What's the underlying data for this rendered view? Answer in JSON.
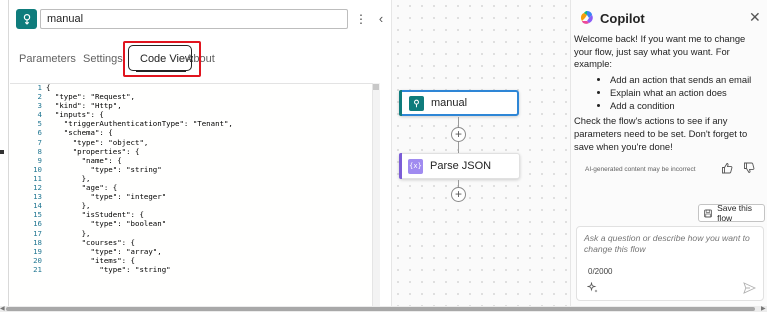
{
  "action_panel": {
    "name_value": "manual",
    "more_label": "⋮",
    "collapse_label": "‹",
    "tabs": [
      {
        "label": "Parameters"
      },
      {
        "label": "Settings"
      },
      {
        "label": "Code View"
      },
      {
        "label": "About"
      }
    ],
    "active_tab": "Code View",
    "code_lines": [
      {
        "n": "1",
        "text": "{"
      },
      {
        "n": "2",
        "text": "  \"type\": \"Request\","
      },
      {
        "n": "3",
        "text": "  \"kind\": \"Http\","
      },
      {
        "n": "4",
        "text": "  \"inputs\": {"
      },
      {
        "n": "5",
        "text": "    \"triggerAuthenticationType\": \"Tenant\","
      },
      {
        "n": "6",
        "text": "    \"schema\": {"
      },
      {
        "n": "7",
        "text": "      \"type\": \"object\","
      },
      {
        "n": "8",
        "text": "      \"properties\": {"
      },
      {
        "n": "9",
        "text": "        \"name\": {"
      },
      {
        "n": "10",
        "text": "          \"type\": \"string\""
      },
      {
        "n": "11",
        "text": "        },"
      },
      {
        "n": "12",
        "text": "        \"age\": {"
      },
      {
        "n": "13",
        "text": "          \"type\": \"integer\""
      },
      {
        "n": "14",
        "text": "        },"
      },
      {
        "n": "15",
        "text": "        \"isStudent\": {"
      },
      {
        "n": "16",
        "text": "          \"type\": \"boolean\""
      },
      {
        "n": "17",
        "text": "        },"
      },
      {
        "n": "18",
        "text": "        \"courses\": {"
      },
      {
        "n": "19",
        "text": "          \"type\": \"array\","
      },
      {
        "n": "20",
        "text": "          \"items\": {"
      },
      {
        "n": "21",
        "text": "            \"type\": \"string\""
      }
    ]
  },
  "canvas": {
    "nodes": [
      {
        "label": "manual"
      },
      {
        "label": "Parse JSON",
        "icon_text": "{x}"
      }
    ],
    "add_label": "+"
  },
  "copilot": {
    "title": "Copilot",
    "close_label": "✕",
    "intro": "Welcome back! If you want me to change your flow, just say what you want. For example:",
    "suggestions": [
      "Add an action that sends an email",
      "Explain what an action does",
      "Add a condition"
    ],
    "followup": "Check the flow's actions to see if any parameters need to be set. Don't forget to save when you're done!",
    "disclaimer": "AI-generated content may be incorrect",
    "save_label": "Save this flow",
    "prompt_placeholder": "Ask a question or describe how you want to change this flow",
    "char_count": "0/2000"
  },
  "colors": {
    "accent_teal": "#0f7c7c",
    "selected_border": "#2e86d6",
    "annotation_red": "#e0141e",
    "parse_icon": "#a08bf0"
  },
  "icons": [
    "trigger-icon",
    "more-icon",
    "chevron-left-icon",
    "copilot-logo-icon",
    "close-icon",
    "thumbs-up-icon",
    "thumbs-down-icon",
    "save-icon",
    "sparkle-icon",
    "send-icon",
    "add-icon"
  ]
}
